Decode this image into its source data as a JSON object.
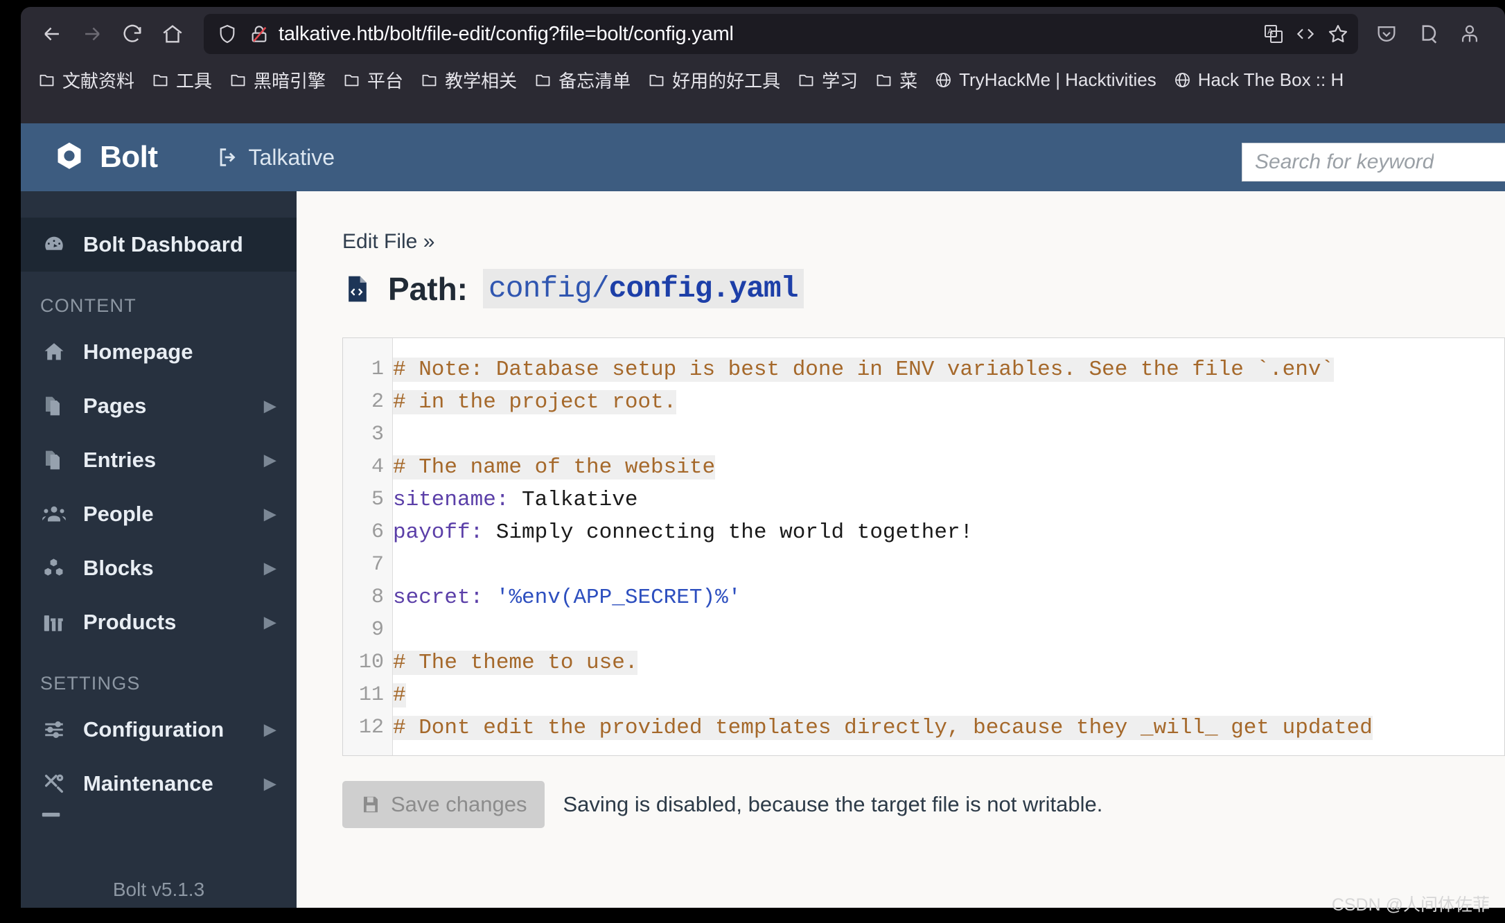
{
  "browser": {
    "url": "talkative.htb/bolt/file-edit/config?file=bolt/config.yaml",
    "nav": {
      "back": "back-arrow",
      "forward": "forward-arrow",
      "reload": "reload",
      "home": "home"
    },
    "url_icons": [
      "shield-icon",
      "broken-lock-icon"
    ],
    "url_actions": [
      "translate-icon",
      "reader-code-icon",
      "bookmark-star-icon"
    ],
    "toolbar_right": [
      "pocket-icon",
      "dashlane-icon",
      "account-icon"
    ],
    "bookmarks": [
      {
        "label": "文献资料",
        "icon": "folder-icon"
      },
      {
        "label": "工具",
        "icon": "folder-icon"
      },
      {
        "label": "黑暗引擎",
        "icon": "folder-icon"
      },
      {
        "label": "平台",
        "icon": "folder-icon"
      },
      {
        "label": "教学相关",
        "icon": "folder-icon"
      },
      {
        "label": "备忘清单",
        "icon": "folder-icon"
      },
      {
        "label": "好用的好工具",
        "icon": "folder-icon"
      },
      {
        "label": "学习",
        "icon": "folder-icon"
      },
      {
        "label": "菜",
        "icon": "folder-icon"
      },
      {
        "label": "TryHackMe | Hacktivities",
        "icon": "globe-icon"
      },
      {
        "label": "Hack The Box :: H",
        "icon": "globe-icon"
      }
    ]
  },
  "header": {
    "brand": "Bolt",
    "site_link": "Talkative",
    "search_placeholder": "Search for keyword"
  },
  "sidebar": {
    "dashboard": {
      "label": "Bolt Dashboard",
      "icon": "tachometer-icon"
    },
    "section_content": "CONTENT",
    "content_items": [
      {
        "label": "Homepage",
        "icon": "home-icon",
        "expandable": false
      },
      {
        "label": "Pages",
        "icon": "files-icon",
        "expandable": true
      },
      {
        "label": "Entries",
        "icon": "files-icon",
        "expandable": true
      },
      {
        "label": "People",
        "icon": "users-icon",
        "expandable": true
      },
      {
        "label": "Blocks",
        "icon": "cubes-icon",
        "expandable": true
      },
      {
        "label": "Products",
        "icon": "gifts-icon",
        "expandable": true
      }
    ],
    "section_settings": "SETTINGS",
    "settings_items": [
      {
        "label": "Configuration",
        "icon": "sliders-icon",
        "expandable": true
      },
      {
        "label": "Maintenance",
        "icon": "tools-icon",
        "expandable": true
      }
    ],
    "version": "Bolt v5.1.3"
  },
  "main": {
    "breadcrumb": "Edit File »",
    "path_label": "Path:",
    "path_dir": "config/",
    "path_file": "config.yaml",
    "file_icon": "file-code-icon",
    "editor": {
      "line_numbers": [
        "1",
        "2",
        "3",
        "4",
        "5",
        "6",
        "7",
        "8",
        "9",
        "10",
        "11",
        "12"
      ],
      "lines": [
        {
          "n": 1,
          "comment": "# Note: Database setup is best done in ENV variables. See the file `.env`"
        },
        {
          "n": 2,
          "comment": "# in the project root."
        },
        {
          "n": 3,
          "blank": true
        },
        {
          "n": 4,
          "comment": "# The name of the website"
        },
        {
          "n": 5,
          "key": "sitename:",
          "value": " Talkative"
        },
        {
          "n": 6,
          "key": "payoff:",
          "value": " Simply connecting the world together!"
        },
        {
          "n": 7,
          "blank": true
        },
        {
          "n": 8,
          "key": "secret:",
          "string": " '%env(APP_SECRET)%'"
        },
        {
          "n": 9,
          "blank": true
        },
        {
          "n": 10,
          "comment": "# The theme to use."
        },
        {
          "n": 11,
          "comment": "#"
        },
        {
          "n": 12,
          "comment": "# Dont edit the provided templates directly, because they _will_ get updated"
        }
      ]
    },
    "save_button": "Save changes",
    "save_icon": "save-icon",
    "save_message": "Saving is disabled, because the target file is not writable."
  },
  "watermark": "CSDN @人间体佐菲"
}
